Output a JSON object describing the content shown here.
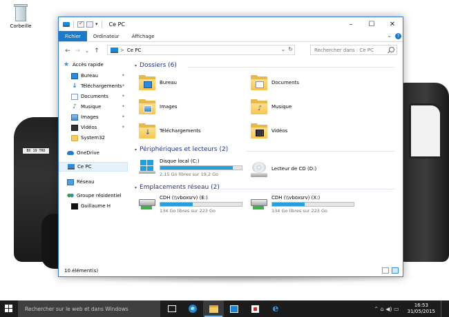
{
  "desktop": {
    "recycle_bin_label": "Corbeille",
    "car_plate": "BX 19 TRD"
  },
  "window": {
    "title": "Ce PC",
    "controls": {
      "minimize": "–",
      "maximize": "☐",
      "close": "✕"
    },
    "quick_access_arrow": "▾",
    "ribbon_tabs": [
      "Fichier",
      "Ordinateur",
      "Affichage"
    ],
    "ribbon_expand": "⌄",
    "ribbon_help": "?",
    "nav": {
      "back": "←",
      "forward": "→",
      "recent": "⌄",
      "up": "↑"
    },
    "address": {
      "chevron": ">",
      "path": "Ce PC",
      "dropdown": "⌄",
      "refresh": "↻"
    },
    "search": {
      "placeholder": "Rechercher dans : Ce PC"
    },
    "status": "10 élément(s)"
  },
  "sidebar": {
    "items": [
      {
        "label": "Accès rapide",
        "icon": "star-icon"
      },
      {
        "label": "Bureau",
        "icon": "desktop-icon",
        "pinned": true
      },
      {
        "label": "Téléchargements",
        "icon": "download-icon",
        "pinned": true
      },
      {
        "label": "Documents",
        "icon": "document-icon",
        "pinned": true
      },
      {
        "label": "Musique",
        "icon": "music-icon",
        "pinned": true
      },
      {
        "label": "Images",
        "icon": "image-icon",
        "pinned": true
      },
      {
        "label": "Vidéos",
        "icon": "video-icon",
        "pinned": true
      },
      {
        "label": "System32",
        "icon": "folder-icon"
      },
      {
        "label": "OneDrive",
        "icon": "cloud-icon"
      },
      {
        "label": "Ce PC",
        "icon": "computer-icon",
        "selected": true
      },
      {
        "label": "Réseau",
        "icon": "network-icon"
      },
      {
        "label": "Groupe résidentiel",
        "icon": "homegroup-icon"
      },
      {
        "label": "Guillaume H",
        "icon": "user-icon"
      }
    ],
    "pin_glyph": "📌"
  },
  "content": {
    "folders_header": "Dossiers (6)",
    "folders": [
      "Bureau",
      "Documents",
      "Images",
      "Musique",
      "Téléchargements",
      "Vidéos"
    ],
    "devices_header": "Périphériques et lecteurs (2)",
    "devices": [
      {
        "name": "Disque local (C:)",
        "free": "2,15 Go libres sur 19,2 Go",
        "used_fraction": 0.89
      },
      {
        "name": "Lecteur de CD (D:)"
      }
    ],
    "network_header": "Emplacements réseau (2)",
    "network": [
      {
        "name": "CDH (\\\\vboxsrv) (E:)",
        "free": "134 Go libres sur 223 Go",
        "used_fraction": 0.4
      },
      {
        "name": "CDH (\\\\vboxsrv) (X:)",
        "free": "134 Go libres sur 223 Go",
        "used_fraction": 0.4
      }
    ]
  },
  "taskbar": {
    "search_placeholder": "Rechercher sur le web et dans Windows",
    "clock_time": "16:53",
    "clock_date": "31/05/2015",
    "tray_icons": "⌃ ⌂ ◀) ▭"
  }
}
